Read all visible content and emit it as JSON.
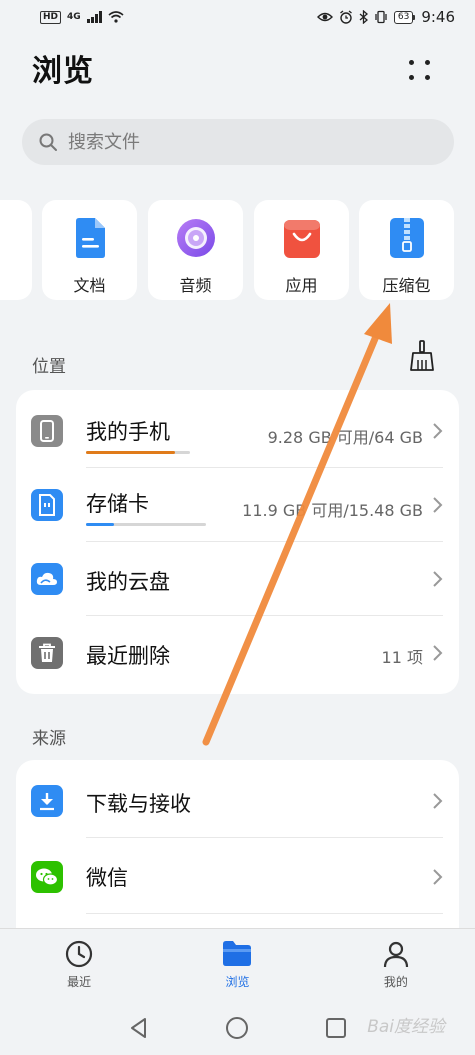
{
  "status_bar": {
    "hd": "HD",
    "network": "4G",
    "battery": "63",
    "time": "9:46"
  },
  "header": {
    "title": "浏览"
  },
  "search": {
    "placeholder": "搜索文件"
  },
  "categories": [
    {
      "label": "文档",
      "icon": "document-icon",
      "color": "#2f8cf3"
    },
    {
      "label": "音频",
      "icon": "audio-disc-icon",
      "color": "#8c5cf0"
    },
    {
      "label": "应用",
      "icon": "shopping-bag-icon",
      "color": "#f0523f"
    },
    {
      "label": "压缩包",
      "icon": "zip-archive-icon",
      "color": "#2f8cf3"
    }
  ],
  "locations": {
    "label": "位置",
    "items": [
      {
        "name": "我的手机",
        "meta": "9.28 GB 可用/64 GB",
        "icon": "phone-icon",
        "usage": 0.86,
        "usage_color": "#e07b1a"
      },
      {
        "name": "存储卡",
        "meta": "11.9 GB 可用/15.48 GB",
        "icon": "sd-card-icon",
        "usage": 0.23,
        "usage_color": "#2f8cf3"
      },
      {
        "name": "我的云盘",
        "meta": "",
        "icon": "cloud-icon"
      },
      {
        "name": "最近删除",
        "meta": "11 项",
        "icon": "trash-icon"
      }
    ]
  },
  "sources": {
    "label": "来源",
    "items": [
      {
        "name": "下载与接收",
        "icon": "download-icon"
      },
      {
        "name": "微信",
        "icon": "wechat-icon"
      }
    ]
  },
  "bottom_nav": [
    {
      "label": "最近",
      "icon": "clock-icon",
      "active": false
    },
    {
      "label": "浏览",
      "icon": "folder-icon",
      "active": true
    },
    {
      "label": "我的",
      "icon": "person-icon",
      "active": false
    }
  ],
  "watermark": "Bai度经验",
  "colors": {
    "accent": "#1f6fe5",
    "annotation_arrow": "#f08a3c"
  }
}
